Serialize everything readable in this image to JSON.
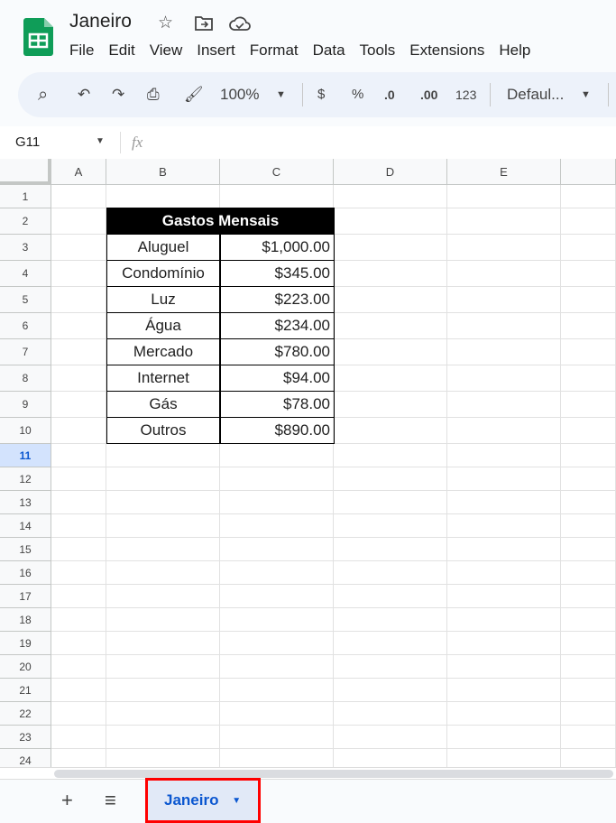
{
  "doc": {
    "title": "Janeiro",
    "icons": [
      "star-icon",
      "move-folder-icon",
      "cloud-saved-icon"
    ]
  },
  "menu": [
    "File",
    "Edit",
    "View",
    "Insert",
    "Format",
    "Data",
    "Tools",
    "Extensions",
    "Help"
  ],
  "toolbar": {
    "zoom": "100%",
    "currency": "$",
    "percent": "%",
    "dec_decrease": ".0",
    "dec_increase": ".00",
    "number_format": "123",
    "font": "Defaul..."
  },
  "formula_bar": {
    "name_box": "G11",
    "fx": "fx",
    "value": ""
  },
  "columns": [
    "A",
    "B",
    "C",
    "D",
    "E",
    ""
  ],
  "rows": [
    "1",
    "2",
    "3",
    "4",
    "5",
    "6",
    "7",
    "8",
    "9",
    "10",
    "11",
    "12",
    "13",
    "14",
    "15",
    "16",
    "17",
    "18",
    "19",
    "20",
    "21",
    "22",
    "23",
    "24"
  ],
  "selected_row": "11",
  "table": {
    "header": "Gastos Mensais",
    "items": [
      {
        "label": "Aluguel",
        "value": "$1,000.00"
      },
      {
        "label": "Condomínio",
        "value": "$345.00"
      },
      {
        "label": "Luz",
        "value": "$223.00"
      },
      {
        "label": "Água",
        "value": "$234.00"
      },
      {
        "label": "Mercado",
        "value": "$780.00"
      },
      {
        "label": "Internet",
        "value": "$94.00"
      },
      {
        "label": "Gás",
        "value": "$78.00"
      },
      {
        "label": "Outros",
        "value": "$890.00"
      }
    ]
  },
  "sheets": {
    "add": "+",
    "list": "≡",
    "active": "Janeiro"
  },
  "colors": {
    "brand": "#0f9d58",
    "accent": "#0b57d0",
    "highlight": "#ff0000"
  }
}
